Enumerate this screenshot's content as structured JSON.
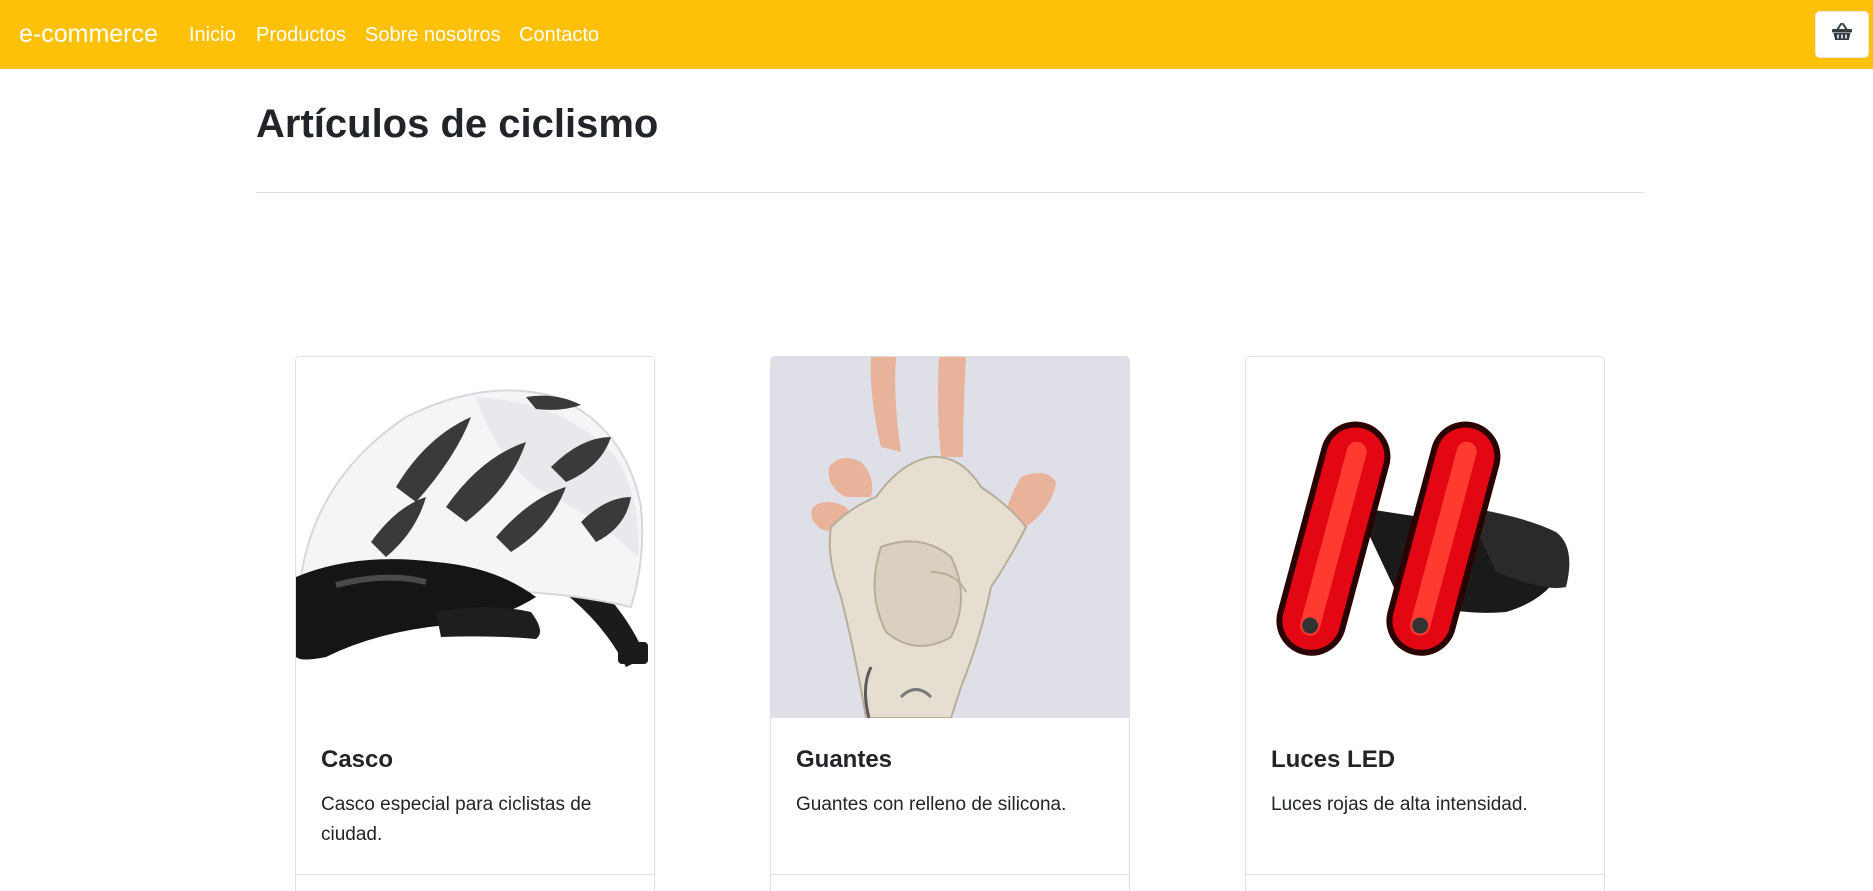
{
  "navbar": {
    "brand": "e-commerce",
    "links": [
      {
        "label": "Inicio"
      },
      {
        "label": "Productos"
      },
      {
        "label": "Sobre nosotros"
      },
      {
        "label": "Contacto"
      }
    ],
    "cart_icon": "shopping-basket-icon",
    "background": "#ffc107"
  },
  "main": {
    "title": "Artículos de ciclismo",
    "products": [
      {
        "name": "Casco",
        "description": "Casco especial para ciclistas de ciudad.",
        "image": "bicycle-helmet-image"
      },
      {
        "name": "Guantes",
        "description": "Guantes con relleno de silicona.",
        "image": "cycling-glove-image"
      },
      {
        "name": "Luces LED",
        "description": "Luces rojas de alta intensidad.",
        "image": "red-led-lights-image"
      }
    ]
  }
}
